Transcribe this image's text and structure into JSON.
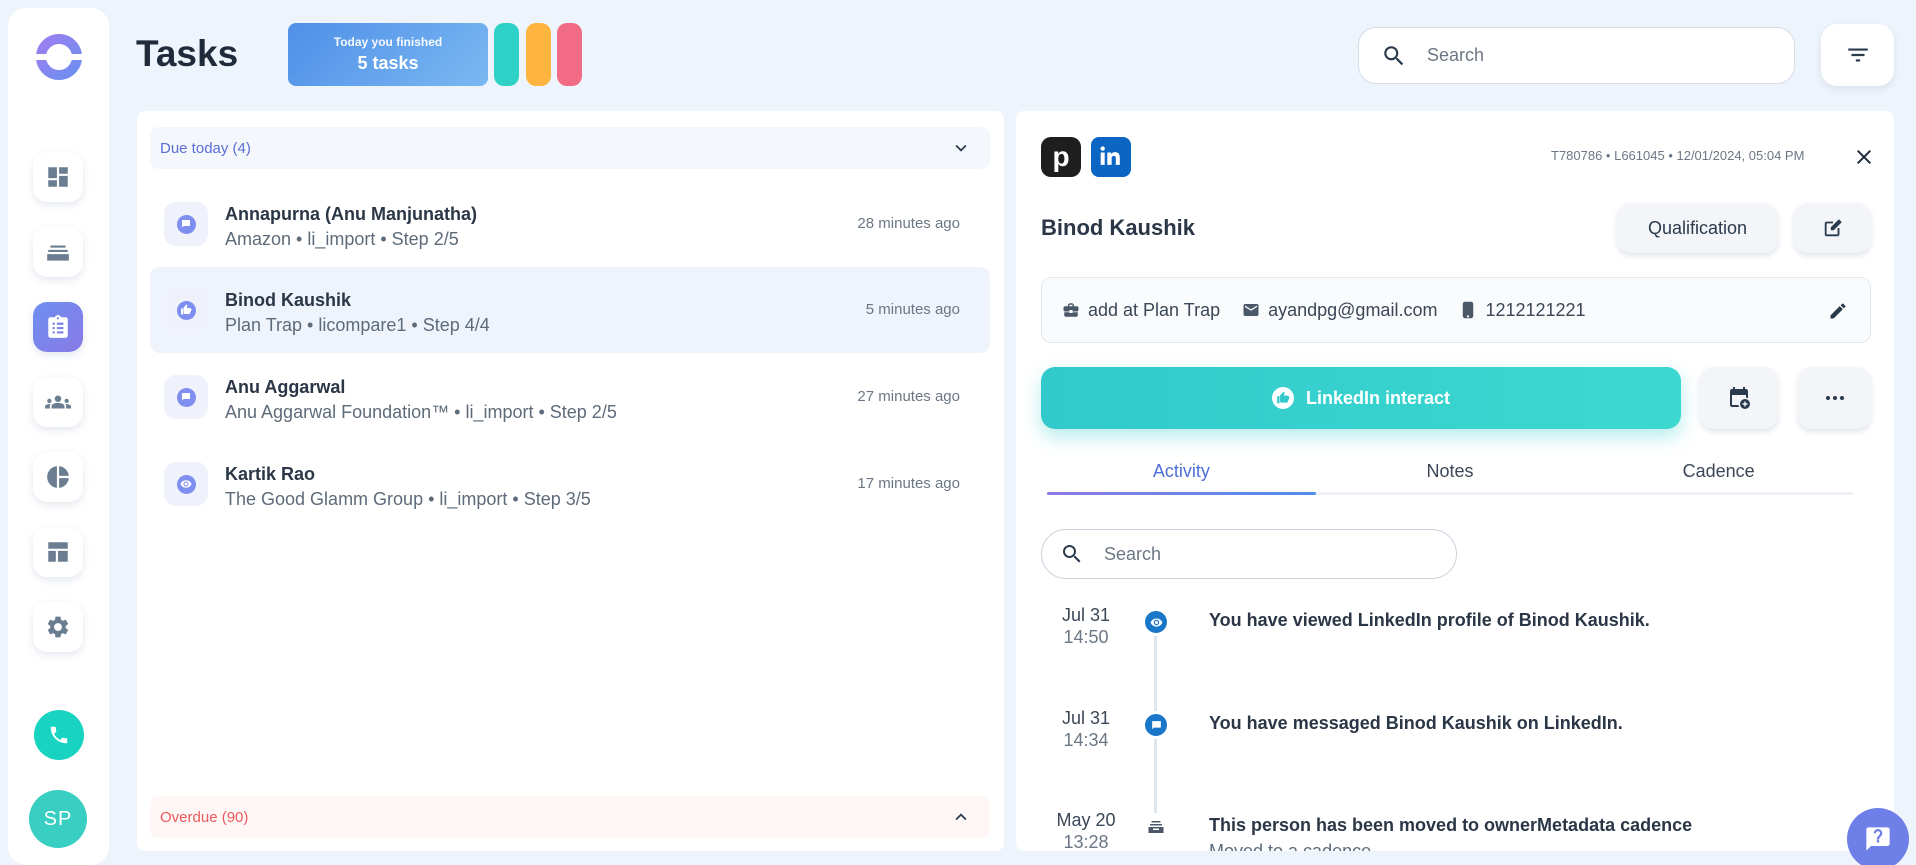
{
  "header": {
    "title": "Tasks",
    "finished_line1": "Today you finished",
    "finished_line2": "5 tasks",
    "pills": [
      "#2fd1c6",
      "#fdb53f",
      "#f26b85"
    ],
    "search_placeholder": "Search"
  },
  "sidebar": {
    "items": [
      "dashboard-icon",
      "layers-icon",
      "tasks-icon",
      "people-icon",
      "pie-chart-icon",
      "layout-icon",
      "gear-icon"
    ],
    "active_index": 2,
    "avatar_initials": "SP"
  },
  "tasks": {
    "due_label": "Due today (4)",
    "overdue_label": "Overdue (90)",
    "items": [
      {
        "name": "Annapurna (Anu Manjunatha)",
        "sub": "Amazon • li_import • Step 2/5",
        "time": "28 minutes ago",
        "icon": "message-icon"
      },
      {
        "name": "Binod Kaushik",
        "sub": "Plan Trap • licompare1 • Step 4/4",
        "time": "5 minutes ago",
        "icon": "like-icon"
      },
      {
        "name": "Anu Aggarwal",
        "sub": "Anu Aggarwal Foundation™ • li_import • Step 2/5",
        "time": "27 minutes ago",
        "icon": "message-icon"
      },
      {
        "name": "Kartik Rao",
        "sub": "The Good Glamm Group • li_import • Step 3/5",
        "time": "17 minutes ago",
        "icon": "eye-icon"
      }
    ]
  },
  "detail": {
    "meta": "T780786 • L661045 • 12/01/2024, 05:04 PM",
    "name": "Binod Kaushik",
    "qualification_label": "Qualification",
    "company": "add at Plan Trap",
    "email": "ayandpg@gmail.com",
    "phone": "1212121221",
    "primary_action": "LinkedIn interact",
    "tabs": [
      "Activity",
      "Notes",
      "Cadence"
    ],
    "active_tab": 0,
    "activity_search_placeholder": "Search",
    "activities": [
      {
        "date": "Jul 31",
        "time": "14:50",
        "title": "You have viewed LinkedIn profile of Binod Kaushik.",
        "sub": "",
        "icon": "eye-icon"
      },
      {
        "date": "Jul 31",
        "time": "14:34",
        "title": "You have messaged Binod Kaushik on LinkedIn.",
        "sub": "",
        "icon": "message-icon"
      },
      {
        "date": "May 20",
        "time": "13:28",
        "title": "This person has been moved to ownerMetadata cadence",
        "sub": "Moved to a cadence",
        "icon": "inbox-icon"
      }
    ]
  }
}
